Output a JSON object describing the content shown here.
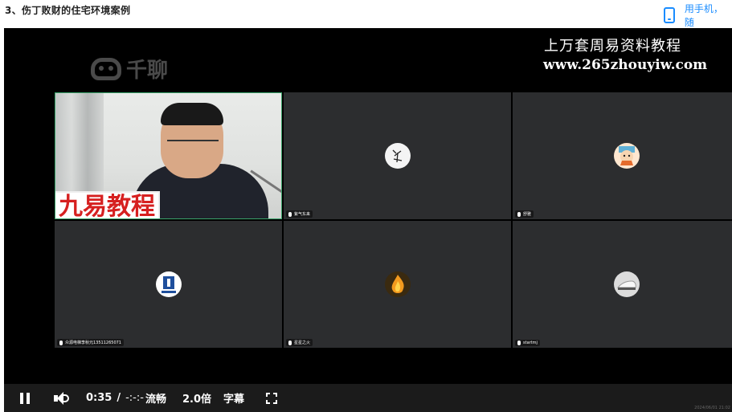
{
  "header": {
    "lesson_title": "3、伤丁败财的住宅环境案例",
    "phone_link": "用手机，随"
  },
  "video": {
    "watermark_brand": "千聊",
    "ad_line1": "上万套周易资料教程",
    "ad_line2": "www.265zhouyiw.com",
    "overlay_logo_text": "九易教程",
    "participants": [
      {
        "label": ""
      },
      {
        "label": "紫气东来",
        "avatar": "calligraphy"
      },
      {
        "label": "舒雅",
        "avatar": "cartoon"
      },
      {
        "label": "众源电梯李秋元13511265071",
        "avatar": "blue-logo"
      },
      {
        "label": "星星之火",
        "avatar": "fire"
      },
      {
        "label": "startmj",
        "avatar": "shoe"
      }
    ],
    "corner_mark": "2024/06/01 21:02"
  },
  "controls": {
    "current_time": "0:35",
    "separator": "/",
    "duration": "-:-:-",
    "quality": "流畅",
    "speed": "2.0倍",
    "subtitles": "字幕"
  },
  "colors": {
    "accent": "#1a8cff",
    "video_bg": "#000000",
    "tile_bg": "#2c2d2f",
    "control_bar": "#1b1b1b",
    "overlay_red": "#d62020"
  }
}
